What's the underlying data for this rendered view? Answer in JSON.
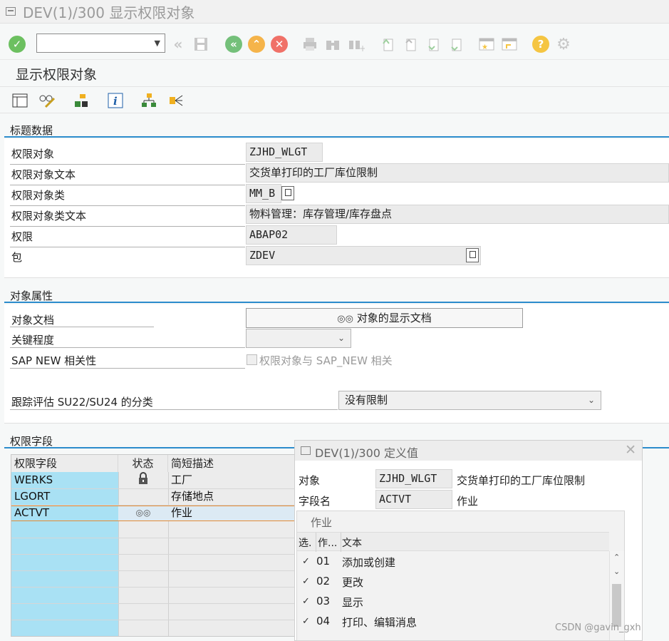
{
  "window": {
    "title": "DEV(1)/300 显示权限对象"
  },
  "screen": {
    "title": "显示权限对象"
  },
  "toolbar": {
    "command_value": ""
  },
  "header_data": {
    "section_title": "标题数据",
    "auth_object_label": "权限对象",
    "auth_object_value": "ZJHD_WLGT",
    "auth_object_text_label": "权限对象文本",
    "auth_object_text_value": "交货单打印的工厂库位限制",
    "auth_object_class_label": "权限对象类",
    "auth_object_class_value": "MM_B",
    "auth_object_class_text_label": "权限对象类文本",
    "auth_object_class_text_value": "物料管理：库存管理/库存盘点",
    "authorization_label": "权限",
    "authorization_value": "ABAP02",
    "package_label": "包",
    "package_value": "ZDEV"
  },
  "object_attributes": {
    "section_title": "对象属性",
    "doc_label": "对象文档",
    "doc_button": "对象的显示文档",
    "criticality_label": "关键程度",
    "criticality_value": "",
    "sap_new_label": "SAP NEW 相关性",
    "sap_new_checkbox_label": "权限对象与 SAP_NEW 相关",
    "trace_label": "跟踪评估 SU22/SU24 的分类",
    "trace_value": "没有限制"
  },
  "auth_fields": {
    "section_title": "权限字段",
    "columns": [
      "权限字段",
      "状态",
      "简短描述"
    ],
    "rows": [
      {
        "field": "WERKS",
        "status": "lock-icon",
        "desc": "工厂"
      },
      {
        "field": "LGORT",
        "status": "",
        "desc": "存储地点"
      },
      {
        "field": "ACTVT",
        "status": "glasses-icon",
        "desc": "作业"
      }
    ]
  },
  "popup": {
    "title": "DEV(1)/300 定义值",
    "object_label": "对象",
    "object_value": "ZJHD_WLGT",
    "object_text": "交货单打印的工厂库位限制",
    "field_label": "字段名",
    "field_value": "ACTVT",
    "field_text": "作业",
    "list_title": "作业",
    "list_columns": [
      "选.",
      "作...",
      "文本"
    ],
    "list_rows": [
      {
        "checked": true,
        "code": "01",
        "text": "添加或创建"
      },
      {
        "checked": true,
        "code": "02",
        "text": "更改"
      },
      {
        "checked": true,
        "code": "03",
        "text": "显示"
      },
      {
        "checked": true,
        "code": "04",
        "text": "打印、编辑消息"
      }
    ]
  },
  "watermark": "CSDN @gavin_gxh",
  "colors": {
    "accent_blue": "#2c8ccc",
    "key_column": "#a9e1f4",
    "ok_green": "#6cc060",
    "nav_green": "#74c07a",
    "nav_orange": "#f5b44a",
    "cancel_red": "#f07168",
    "help_yellow": "#f5c542"
  }
}
